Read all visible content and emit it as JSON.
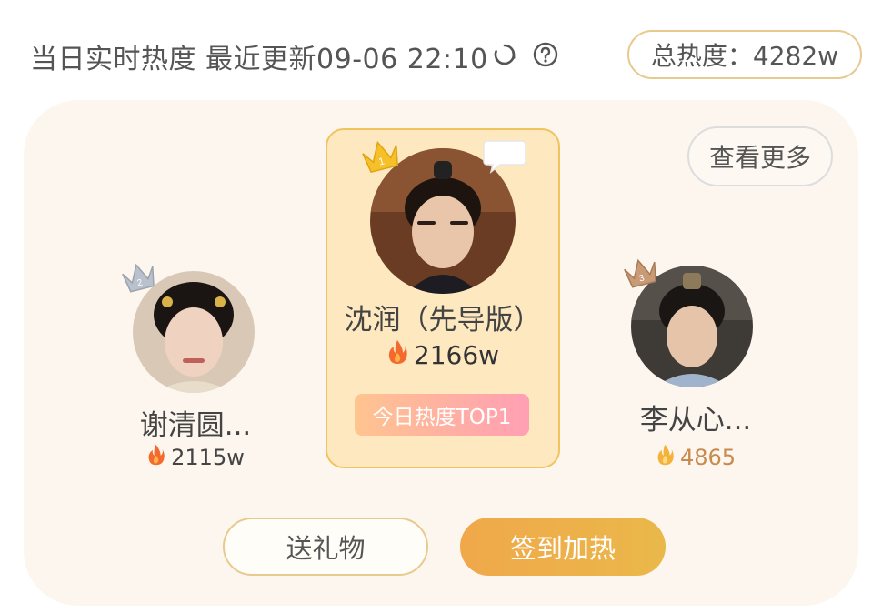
{
  "header": {
    "title": "当日实时热度 最近更新09-06 22:10",
    "total_heat": "总热度：4282w"
  },
  "panel": {
    "more_label": "查看更多"
  },
  "ranking": {
    "first": {
      "rank": "1",
      "name": "沈润（先导版）",
      "heat": "2166w",
      "badge": "今日热度TOP1"
    },
    "second": {
      "rank": "2",
      "name": "谢清圆...",
      "heat": "2115w"
    },
    "third": {
      "rank": "3",
      "name": "李从心...",
      "heat": "4865"
    }
  },
  "actions": {
    "gift_label": "送礼物",
    "checkin_label": "签到加热"
  },
  "colors": {
    "accent": "#f0a84a",
    "card_bg": "#fde8bf",
    "panel_bg": "#fdf6ee",
    "crown_gold": "#f5c02a",
    "crown_silver": "#b9c1cc",
    "crown_bronze": "#c99a76"
  },
  "icons": [
    "refresh-icon",
    "help-icon",
    "crown-icon",
    "chat-bubble-icon",
    "flame-icon"
  ]
}
